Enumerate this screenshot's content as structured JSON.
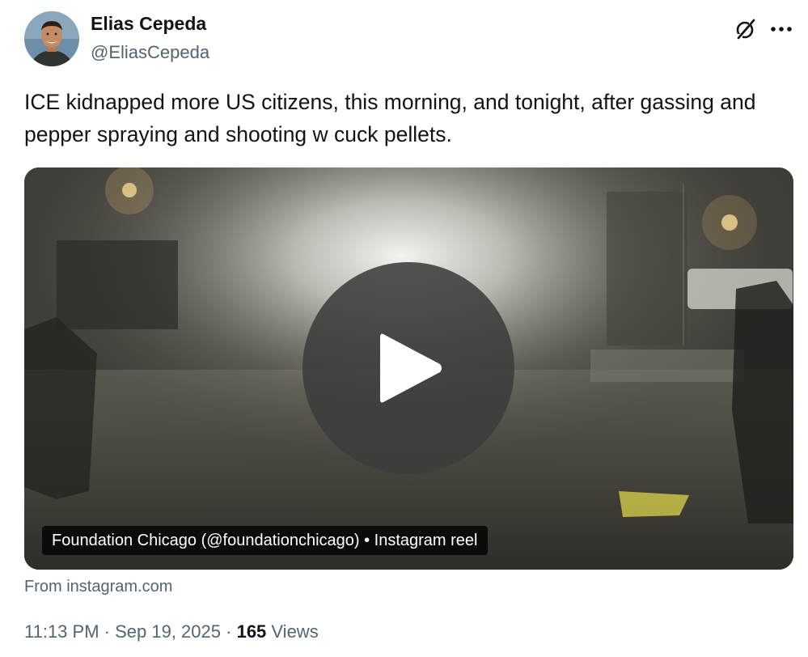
{
  "author": {
    "display_name": "Elias Cepeda",
    "handle": "@EliasCepeda",
    "avatar_icon": "profile-photo"
  },
  "header_actions": {
    "grok_icon": "grok-icon",
    "more_icon": "more-dots-icon"
  },
  "tweet": {
    "text": "ICE kidnapped more US citizens, this morning, and tonight, after gassing and pepper spraying and shooting w cuck pellets."
  },
  "media": {
    "caption": "Foundation Chicago (@foundationchicago) • Instagram reel",
    "play_icon": "play-icon",
    "source": "From instagram.com"
  },
  "meta": {
    "time": "11:13 PM",
    "separator": " · ",
    "date": "Sep 19, 2025",
    "views_separator": " · ",
    "views_count": "165",
    "views_label": " Views"
  }
}
